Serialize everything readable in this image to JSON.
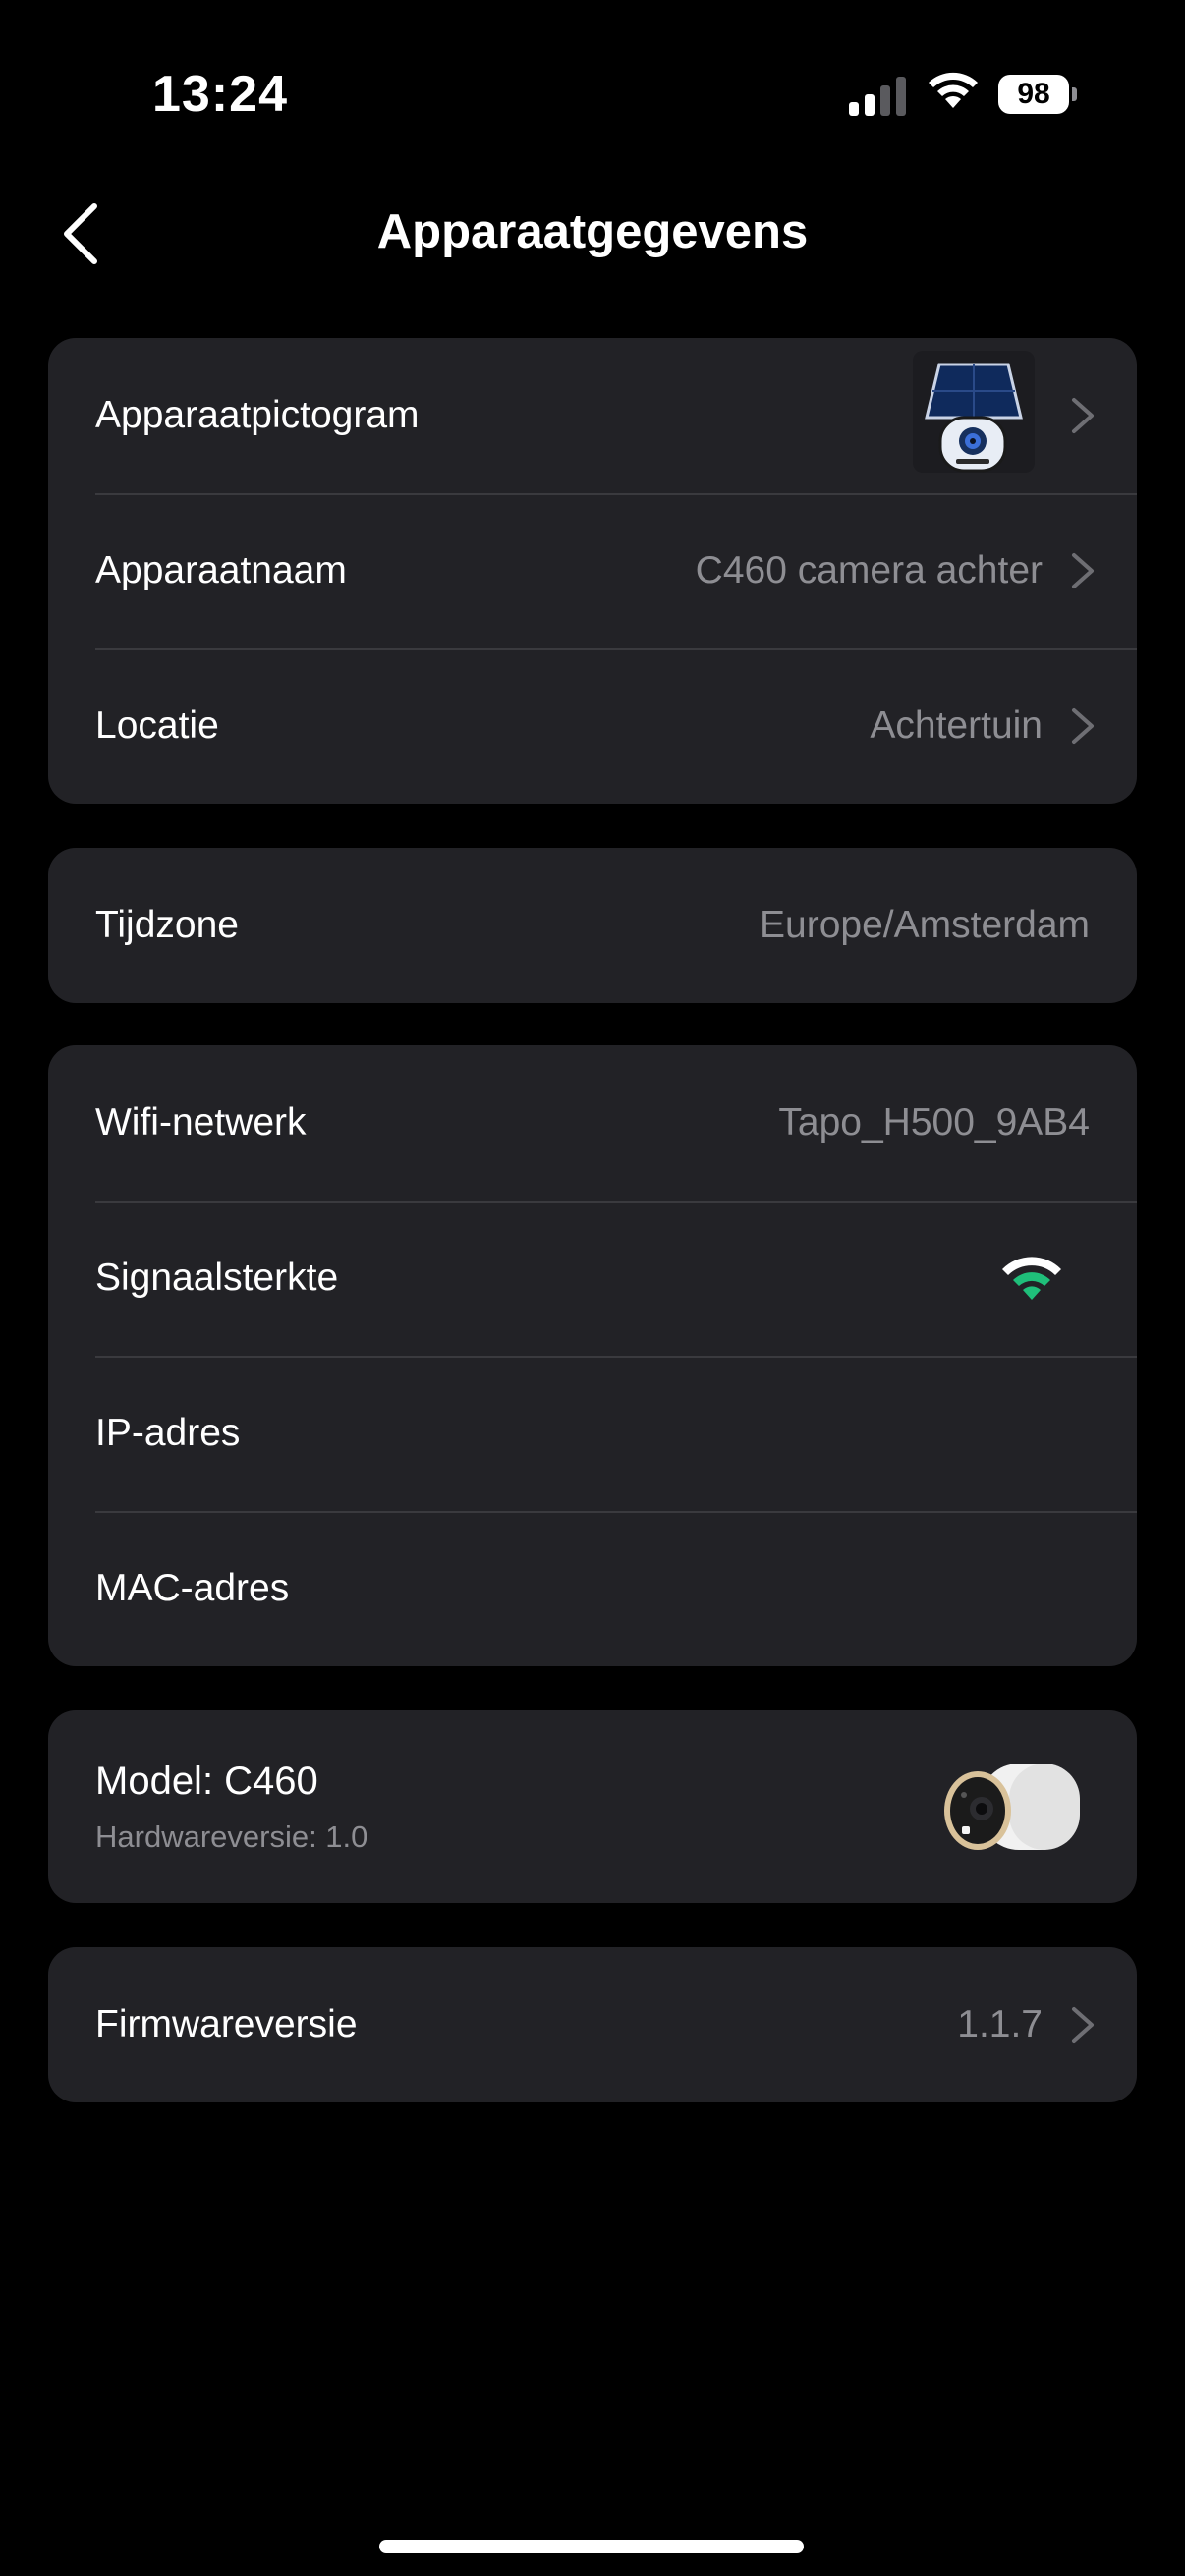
{
  "status_bar": {
    "time": "13:24",
    "battery_percent": "98",
    "cell_signal_bars_active": 2,
    "cell_signal_bars_total": 4
  },
  "nav": {
    "title": "Apparaatgegevens",
    "back_icon": "chevron-left-icon"
  },
  "device_section": {
    "icon_label": "Apparaatpictogram",
    "name_label": "Apparaatnaam",
    "name_value": "C460 camera achter",
    "location_label": "Locatie",
    "location_value": "Achtertuin"
  },
  "timezone_section": {
    "label": "Tijdzone",
    "value": "Europe/Amsterdam"
  },
  "network_section": {
    "wifi_label": "Wifi-netwerk",
    "wifi_value": "Tapo_H500_9AB4",
    "signal_label": "Signaalsterkte",
    "signal_icon": "wifi-signal-icon",
    "signal_bars_active": 1,
    "signal_bars_total": 3,
    "ip_label": "IP-adres",
    "mac_label": "MAC-adres"
  },
  "model_section": {
    "model": "Model: C460",
    "hardware": "Hardwareversie: 1.0"
  },
  "firmware_section": {
    "label": "Firmwareversie",
    "value": "1.1.7"
  },
  "colors": {
    "background": "#000000",
    "card": "#222226",
    "divider": "#3a3a3e",
    "secondary_text": "#8e8e93",
    "signal_active": "#1fbf7a",
    "signal_inactive": "#ffffff"
  }
}
